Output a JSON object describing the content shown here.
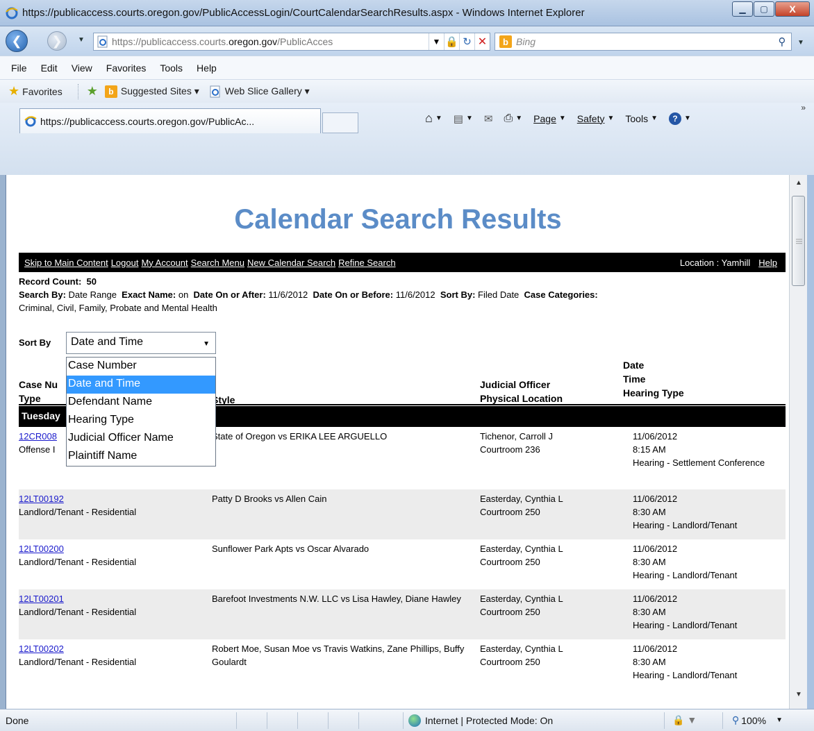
{
  "window": {
    "title": "https://publicaccess.courts.oregon.gov/PublicAccessLogin/CourtCalendarSearchResults.aspx - Windows Internet Explorer",
    "minimize": "▁",
    "maximize": "▢",
    "close": "X"
  },
  "address_bar": {
    "url_prefix": "https://publicaccess.courts.",
    "url_domain": "oregon.gov",
    "url_rest": "/PublicAcces"
  },
  "search_box": {
    "placeholder": "Bing"
  },
  "menu": [
    "File",
    "Edit",
    "View",
    "Favorites",
    "Tools",
    "Help"
  ],
  "favorites_bar": {
    "favorites": "Favorites",
    "suggested_sites": "Suggested Sites ▾",
    "web_slice_gallery": "Web Slice Gallery ▾"
  },
  "tab": {
    "title": "https://publicaccess.courts.oregon.gov/PublicAc..."
  },
  "command_bar": {
    "page": "Page",
    "safety": "Safety",
    "tools": "Tools"
  },
  "page": {
    "title": "Calendar Search Results",
    "nav_links": [
      "Skip to Main Content",
      "Logout",
      "My Account",
      "Search Menu",
      "New Calendar Search",
      "Refine Search"
    ],
    "location": "Location : Yamhill",
    "help": "Help",
    "record_count_label": "Record Count:",
    "record_count": "50",
    "search_by_label": "Search By:",
    "search_by": "Date Range",
    "exact_name_label": "Exact Name:",
    "exact_name": "on",
    "date_after_label": "Date On or After:",
    "date_after": "11/6/2012",
    "date_before_label": "Date On or Before:",
    "date_before": "11/6/2012",
    "sort_by_label": "Sort By:",
    "sort_by": "Filed Date",
    "case_categories_label": "Case Categories:",
    "case_categories": "Criminal, Civil, Family, Probate and Mental Health",
    "sort_label": "Sort By",
    "sort_selected": "Date and Time",
    "sort_options": [
      "Case Number",
      "Date and Time",
      "Defendant Name",
      "Hearing Type",
      "Judicial Officer Name",
      "Plaintiff Name"
    ],
    "headers": {
      "col1_line1": "Case Nu",
      "col1_line2": "Type",
      "col2": "Style",
      "col3_line1": "Judicial Officer",
      "col3_line2": "Physical Location",
      "col4_line1": "Date",
      "col4_line2": "Time",
      "col4_line3": "Hearing Type"
    },
    "day_header": "Tuesday",
    "rows": [
      {
        "case": "12CR008",
        "type": "Offense I",
        "style": "State of Oregon vs ERIKA LEE ARGUELLO",
        "officer": "Tichenor, Carroll J",
        "location": "Courtroom 236",
        "date": "11/06/2012",
        "time": "8:15 AM",
        "hearing": "Hearing - Settlement Conference"
      },
      {
        "case": "12LT00192",
        "type": "Landlord/Tenant - Residential",
        "style": "Patty D Brooks vs Allen Cain",
        "officer": "Easterday, Cynthia L",
        "location": "Courtroom 250",
        "date": "11/06/2012",
        "time": "8:30 AM",
        "hearing": "Hearing - Landlord/Tenant"
      },
      {
        "case": "12LT00200",
        "type": "Landlord/Tenant - Residential",
        "style": "Sunflower Park Apts vs Oscar Alvarado",
        "officer": "Easterday, Cynthia L",
        "location": "Courtroom 250",
        "date": "11/06/2012",
        "time": "8:30 AM",
        "hearing": "Hearing - Landlord/Tenant"
      },
      {
        "case": "12LT00201",
        "type": "Landlord/Tenant - Residential",
        "style": "Barefoot Investments N.W. LLC vs Lisa Hawley, Diane Hawley",
        "officer": "Easterday, Cynthia L",
        "location": "Courtroom 250",
        "date": "11/06/2012",
        "time": "8:30 AM",
        "hearing": "Hearing - Landlord/Tenant"
      },
      {
        "case": "12LT00202",
        "type": "Landlord/Tenant - Residential",
        "style": "Robert Moe, Susan Moe vs Travis Watkins, Zane Phillips, Buffy Goulardt",
        "officer": "Easterday, Cynthia L",
        "location": "Courtroom 250",
        "date": "11/06/2012",
        "time": "8:30 AM",
        "hearing": "Hearing - Landlord/Tenant"
      }
    ]
  },
  "status_bar": {
    "status": "Done",
    "zone": "Internet | Protected Mode: On",
    "zoom": "100%"
  },
  "colors": {
    "title_blue": "#5b8cc7",
    "selection_blue": "#3399ff",
    "link_blue": "#1a1acc"
  }
}
